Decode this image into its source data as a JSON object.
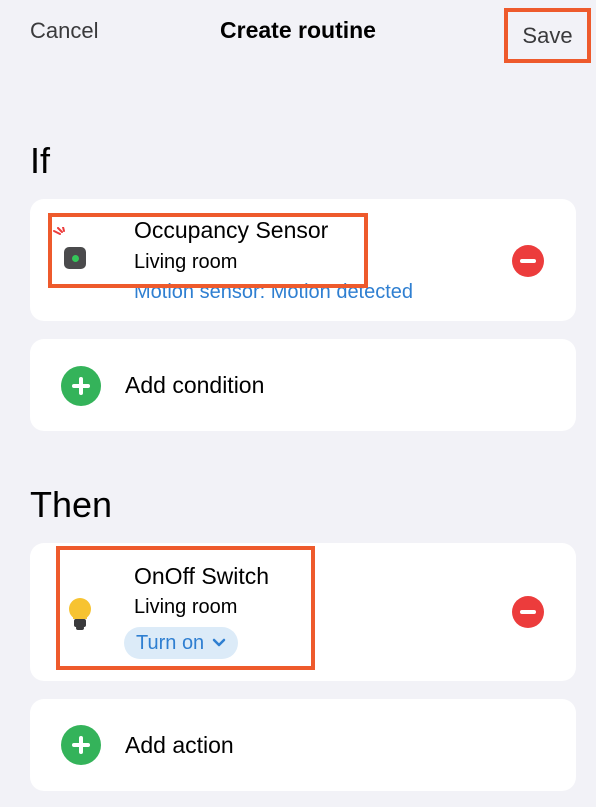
{
  "nav": {
    "cancel_label": "Cancel",
    "title": "Create routine",
    "save_label": "Save"
  },
  "if_section": {
    "title": "If",
    "condition": {
      "name": "Occupancy Sensor",
      "room": "Living room",
      "detail": "Motion sensor: Motion detected",
      "icon": "occupancy-sensor-icon"
    },
    "add_label": "Add condition"
  },
  "then_section": {
    "title": "Then",
    "action": {
      "name": "OnOff Switch",
      "room": "Living room",
      "state": "Turn on",
      "icon": "light-bulb-icon"
    },
    "add_label": "Add action"
  },
  "colors": {
    "highlight": "#ee5a2c",
    "remove": "#ec3c3c",
    "add": "#34b35a",
    "link": "#2f7fd1"
  }
}
